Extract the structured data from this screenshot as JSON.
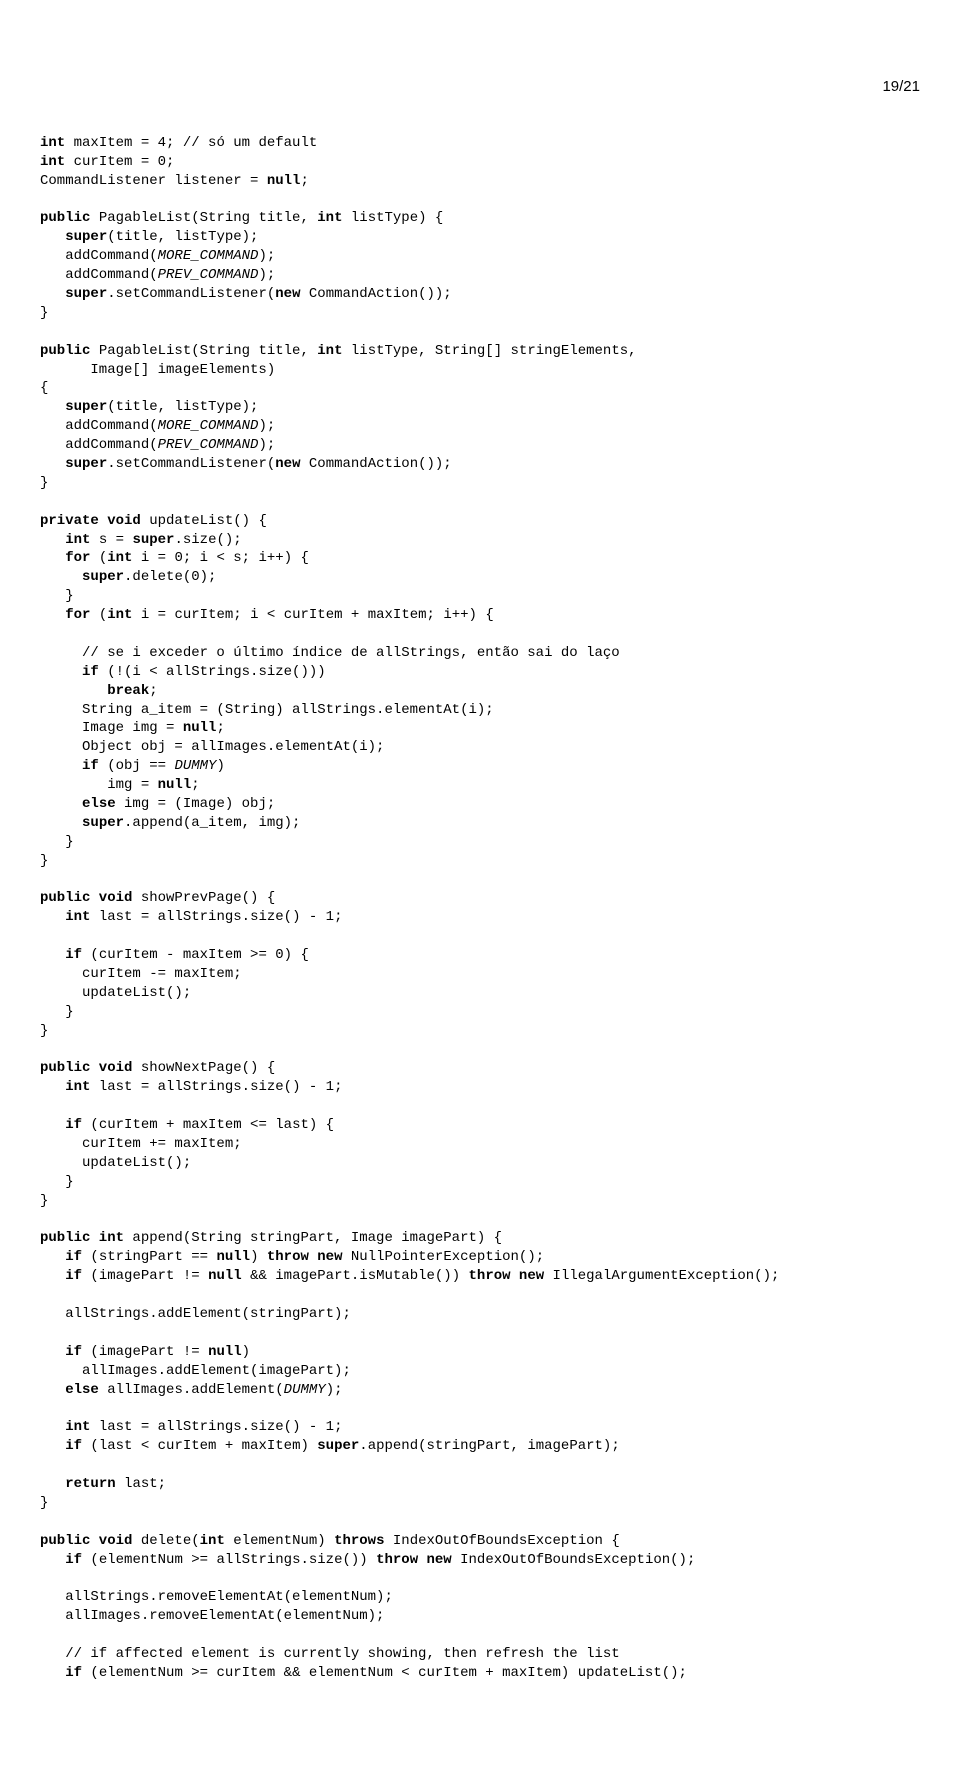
{
  "pageNumber": "19/21",
  "code": {
    "l01": "int maxItem = 4; // só um default",
    "l01a": "int",
    "l01b": " maxItem = 4; // só um default",
    "l02a": "int",
    "l02b": " curItem = 0;",
    "l03a": "CommandListener listener = ",
    "l03b": "null",
    "l03c": ";",
    "blank": "",
    "l05a": "public",
    "l05b": " PagableList(String title, ",
    "l05c": "int",
    "l05d": " listType) {",
    "l06a": "   ",
    "l06b": "super",
    "l06c": "(title, listType);",
    "l07a": "   addCommand(",
    "l07b": "MORE_COMMAND",
    "l07c": ");",
    "l08a": "   addCommand(",
    "l08b": "PREV_COMMAND",
    "l08c": ");",
    "l09a": "   ",
    "l09b": "super",
    "l09c": ".setCommandListener(",
    "l09d": "new",
    "l09e": " CommandAction());",
    "l10": "}",
    "l12a": "public",
    "l12b": " PagableList(String title, ",
    "l12c": "int",
    "l12d": " listType, String[] stringElements,",
    "l13": "      Image[] imageElements)",
    "l14": "{",
    "l15a": "   ",
    "l15b": "super",
    "l15c": "(title, listType);",
    "l16a": "   addCommand(",
    "l16b": "MORE_COMMAND",
    "l16c": ");",
    "l17a": "   addCommand(",
    "l17b": "PREV_COMMAND",
    "l17c": ");",
    "l18a": "   ",
    "l18b": "super",
    "l18c": ".setCommandListener(",
    "l18d": "new",
    "l18e": " CommandAction());",
    "l19": "}",
    "l21a": "private void",
    "l21b": " updateList() {",
    "l22a": "   ",
    "l22b": "int",
    "l22c": " s = ",
    "l22d": "super",
    "l22e": ".size();",
    "l23a": "   ",
    "l23b": "for",
    "l23c": " (",
    "l23d": "int",
    "l23e": " i = 0; i < s; i++) {",
    "l24a": "     ",
    "l24b": "super",
    "l24c": ".delete(0);",
    "l25": "   }",
    "l26a": "   ",
    "l26b": "for",
    "l26c": " (",
    "l26d": "int",
    "l26e": " i = curItem; i < curItem + maxItem; i++) {",
    "l28": "     // se i exceder o último índice de allStrings, então sai do laço",
    "l29a": "     ",
    "l29b": "if",
    "l29c": " (!(i < allStrings.size()))",
    "l30a": "        ",
    "l30b": "break",
    "l30c": ";",
    "l31": "     String a_item = (String) allStrings.elementAt(i);",
    "l32a": "     Image img = ",
    "l32b": "null",
    "l32c": ";",
    "l33": "     Object obj = allImages.elementAt(i);",
    "l34a": "     ",
    "l34b": "if",
    "l34c": " (obj == ",
    "l34d": "DUMMY",
    "l34e": ")",
    "l35a": "        img = ",
    "l35b": "null",
    "l35c": ";",
    "l36a": "     ",
    "l36b": "else",
    "l36c": " img = (Image) obj;",
    "l37a": "     ",
    "l37b": "super",
    "l37c": ".append(a_item, img);",
    "l38": "   }",
    "l39": "}",
    "l41a": "public void",
    "l41b": " showPrevPage() {",
    "l42a": "   ",
    "l42b": "int",
    "l42c": " last = allStrings.size() - 1;",
    "l44a": "   ",
    "l44b": "if",
    "l44c": " (curItem - maxItem >= 0) {",
    "l45": "     curItem -= maxItem;",
    "l46": "     updateList();",
    "l47": "   }",
    "l48": "}",
    "l50a": "public void",
    "l50b": " showNextPage() {",
    "l51a": "   ",
    "l51b": "int",
    "l51c": " last = allStrings.size() - 1;",
    "l53a": "   ",
    "l53b": "if",
    "l53c": " (curItem + maxItem <= last) {",
    "l54": "     curItem += maxItem;",
    "l55": "     updateList();",
    "l56": "   }",
    "l57": "}",
    "l59a": "public int",
    "l59b": " append(String stringPart, Image imagePart) {",
    "l60a": "   ",
    "l60b": "if",
    "l60c": " (stringPart == ",
    "l60d": "null",
    "l60e": ") ",
    "l60f": "throw new",
    "l60g": " NullPointerException();",
    "l61a": "   ",
    "l61b": "if",
    "l61c": " (imagePart != ",
    "l61d": "null",
    "l61e": " && imagePart.isMutable()) ",
    "l61f": "throw new",
    "l61g": " IllegalArgumentException();",
    "l63": "   allStrings.addElement(stringPart);",
    "l65a": "   ",
    "l65b": "if",
    "l65c": " (imagePart != ",
    "l65d": "null",
    "l65e": ")",
    "l66": "     allImages.addElement(imagePart);",
    "l67a": "   ",
    "l67b": "else",
    "l67c": " allImages.addElement(",
    "l67d": "DUMMY",
    "l67e": ");",
    "l69a": "   ",
    "l69b": "int",
    "l69c": " last = allStrings.size() - 1;",
    "l70a": "   ",
    "l70b": "if",
    "l70c": " (last < curItem + maxItem) ",
    "l70d": "super",
    "l70e": ".append(stringPart, imagePart);",
    "l72a": "   ",
    "l72b": "return",
    "l72c": " last;",
    "l73": "}",
    "l75a": "public void",
    "l75b": " delete(",
    "l75c": "int",
    "l75d": " elementNum) ",
    "l75e": "throws",
    "l75f": " IndexOutOfBoundsException {",
    "l76a": "   ",
    "l76b": "if",
    "l76c": " (elementNum >= allStrings.size()) ",
    "l76d": "throw new",
    "l76e": " IndexOutOfBoundsException();",
    "l78": "   allStrings.removeElementAt(elementNum);",
    "l79": "   allImages.removeElementAt(elementNum);",
    "l81": "   // if affected element is currently showing, then refresh the list",
    "l82a": "   ",
    "l82b": "if",
    "l82c": " (elementNum >= curItem && elementNum < curItem + maxItem) updateList();"
  }
}
